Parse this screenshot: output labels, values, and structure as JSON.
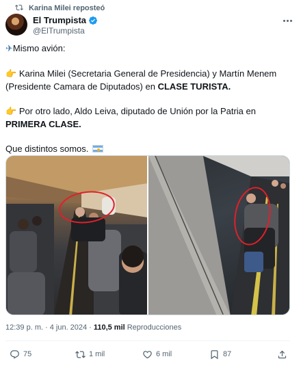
{
  "repost": {
    "label": "Karina Milei reposteó"
  },
  "author": {
    "name": "El Trumpista",
    "handle": "@ElTrumpista",
    "verified": true
  },
  "tweet": {
    "line1_text": "Mismo avión:",
    "line2_text": "Karina Milei (Secretaria General de Presidencia) y Martín Menem (Presidente Camara de Diputados) en ",
    "line2_bold": "CLASE TURISTA.",
    "line3_text": "Por otro lado, Aldo Leiva, diputado de Unión por la Patria en ",
    "line3_bold": "PRIMERA CLASE.",
    "line4_text": "Que distintos somos."
  },
  "meta": {
    "time": "12:39 p. m.",
    "separator": "·",
    "date": "4 jun. 2024",
    "separator2": "·",
    "views_count": "110,5 mil",
    "views_label": "Reproducciones"
  },
  "actions": {
    "replies": "75",
    "reposts": "1 mil",
    "likes": "6 mil",
    "bookmarks": "87"
  },
  "colors": {
    "verified_blue": "#1d9bf0",
    "text_primary": "#0f1419",
    "text_secondary": "#536471",
    "circle_red": "#e0202a"
  }
}
